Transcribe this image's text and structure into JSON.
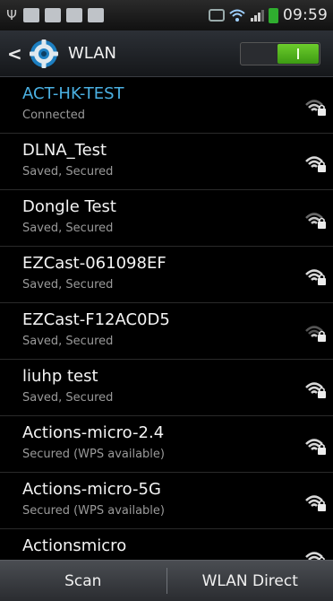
{
  "status_bar": {
    "time": "09:59",
    "icons": [
      "usb-icon",
      "sd-card-icon",
      "document-icon",
      "phone-icon",
      "image-icon",
      "mute-icon",
      "wifi-icon",
      "signal-icon",
      "battery-icon"
    ]
  },
  "header": {
    "back_icon": "chevron-left-icon",
    "settings_icon": "gear-icon",
    "title": "WLAN",
    "toggle_state": "on"
  },
  "networks": [
    {
      "ssid": "ACT-HK-TEST",
      "status": "Connected",
      "connected": true
    },
    {
      "ssid": "DLNA_Test",
      "status": "Saved, Secured",
      "connected": false
    },
    {
      "ssid": "Dongle Test",
      "status": "Saved, Secured",
      "connected": false
    },
    {
      "ssid": "EZCast-061098EF",
      "status": "Saved, Secured",
      "connected": false
    },
    {
      "ssid": "EZCast-F12AC0D5",
      "status": "Saved, Secured",
      "connected": false
    },
    {
      "ssid": "liuhp test",
      "status": "Saved, Secured",
      "connected": false
    },
    {
      "ssid": "Actions-micro-2.4",
      "status": "Secured (WPS available)",
      "connected": false
    },
    {
      "ssid": "Actions-micro-5G",
      "status": "Secured (WPS available)",
      "connected": false
    },
    {
      "ssid": "Actionsmicro",
      "status": "",
      "connected": false
    }
  ],
  "bottom_bar": {
    "scan_label": "Scan",
    "wlan_direct_label": "WLAN Direct"
  },
  "colors": {
    "accent": "#4bb1e3",
    "toggle_on": "#4fb01c"
  }
}
